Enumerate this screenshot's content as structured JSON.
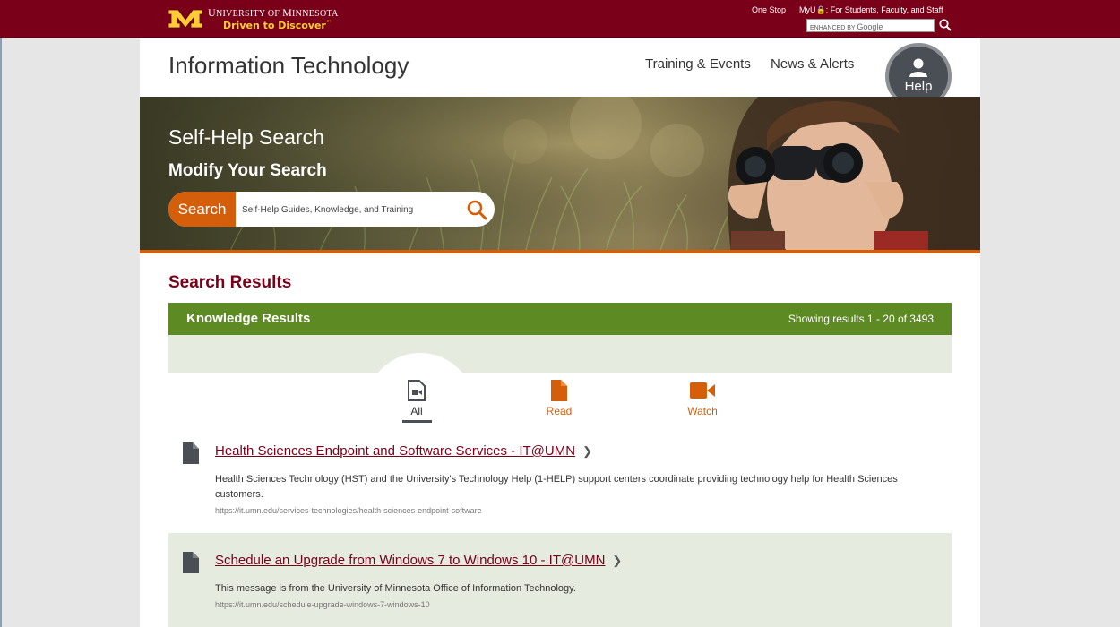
{
  "header": {
    "university_name_1": "U",
    "university_name_2": "NIVERSITY OF ",
    "university_name_3": "M",
    "university_name_4": "INNESOTA",
    "tagline": "Driven to Discover",
    "tagline_mark": "℠",
    "one_stop": "One Stop",
    "myu": "MyU",
    "myu_suffix": ": For Students, Faculty, and Staff",
    "google_prefix": "ENHANCED BY",
    "google_brand": "Google",
    "colors": {
      "maroon": "#7a0019",
      "gold": "#ffcc33"
    }
  },
  "site": {
    "title": "Information Technology",
    "nav": [
      "Training & Events",
      "News & Alerts"
    ],
    "help_label": "Help"
  },
  "hero": {
    "heading": "Self-Help Search",
    "subheading": "Modify Your Search",
    "search_button": "Search",
    "search_placeholder": "Self-Help Guides, Knowledge, and Training",
    "accent": "#d55e0a"
  },
  "results": {
    "title": "Search Results",
    "bar_title": "Knowledge Results",
    "count_text": "Showing results 1 - 20 of 3493",
    "bar_color": "#5e8a24",
    "tabs": [
      {
        "label": "All",
        "icon": "video-file-icon",
        "active": true
      },
      {
        "label": "Read",
        "icon": "document-icon",
        "active": false
      },
      {
        "label": "Watch",
        "icon": "video-camera-icon",
        "active": false
      }
    ],
    "items": [
      {
        "title": "Health Sciences Endpoint and Software Services - IT@UMN",
        "description": "Health Sciences Technology (HST) and the University's Technology Help (1-HELP) support centers coordinate providing technology help for Health Sciences customers.",
        "url": "https://it.umn.edu/services-technologies/health-sciences-endpoint-software"
      },
      {
        "title": "Schedule an Upgrade from Windows 7 to Windows 10 - IT@UMN",
        "description": "This message is from the University of Minnesota Office of Information Technology.",
        "url": "https://it.umn.edu/schedule-upgrade-windows-7-windows-10"
      }
    ]
  }
}
